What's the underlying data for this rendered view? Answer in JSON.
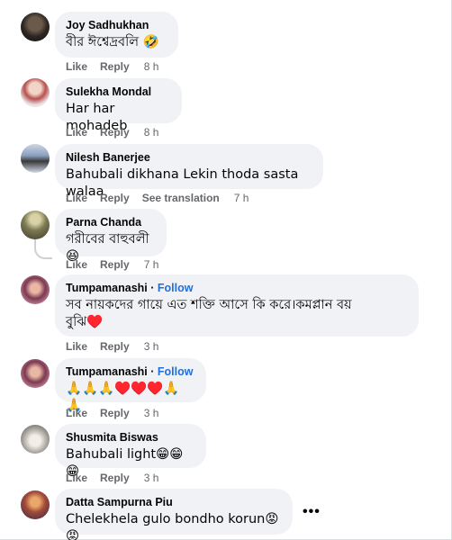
{
  "comments": [
    {
      "author": "Joy Sadhukhan",
      "text": "বীর ঈশ্বেদ্রবলি 🤣",
      "like": "Like",
      "reply": "Reply",
      "time": "8 h"
    },
    {
      "author": "Sulekha Mondal",
      "text": "Har har mohadeb",
      "like": "Like",
      "reply": "Reply",
      "time": "8 h"
    },
    {
      "author": "Nilesh Banerjee",
      "text": "Bahubali dikhana Lekin thoda sasta walaa",
      "like": "Like",
      "reply": "Reply",
      "translate": "See translation",
      "time": "7 h"
    },
    {
      "author": "Parna Chanda",
      "text": "গরীবের বাহুবলী 😆",
      "like": "Like",
      "reply": "Reply",
      "time": "7 h"
    },
    {
      "author": "Tumpamanashi",
      "follow": "Follow",
      "text_line1": "সব নায়কদের গায়ে এত শক্তি আসে কি করে।কমপ্লান বয়",
      "text_line2": "বুঝি♥️",
      "like": "Like",
      "reply": "Reply",
      "time": "3 h"
    },
    {
      "author": "Tumpamanashi",
      "follow": "Follow",
      "text": "🙏🙏🙏♥️♥️♥️🙏🙏",
      "like": "Like",
      "reply": "Reply",
      "time": "3 h"
    },
    {
      "author": "Shusmita Biswas",
      "text": "Bahubali light😁😁😁",
      "like": "Like",
      "reply": "Reply",
      "time": "3 h"
    },
    {
      "author": "Datta Sampurna Piu",
      "text": "Chelekhela gulo bondho korun😡😡",
      "more": "•••"
    }
  ],
  "separator": " · ",
  "colors": {
    "bubble": "#f0f2f5",
    "meta": "#65676b",
    "follow": "#216fdb"
  }
}
